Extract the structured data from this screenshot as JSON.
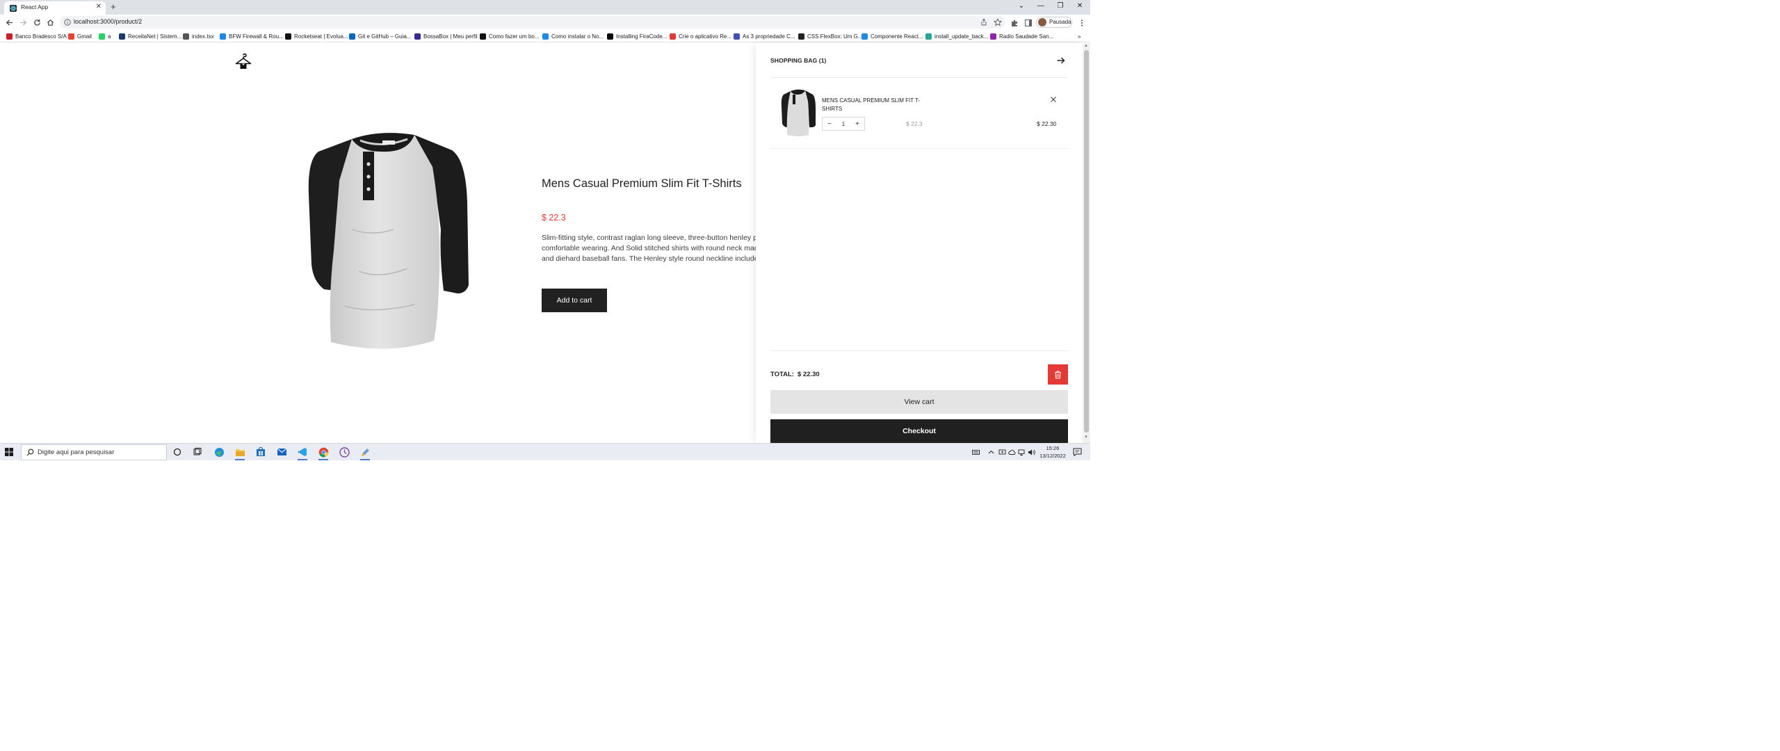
{
  "browser": {
    "tab_title": "React App",
    "tab_close": "✕",
    "new_tab": "+",
    "url": "localhost:3000/product/2",
    "profile_label": "Pausada",
    "window_controls": [
      "⌄",
      "—",
      "❐",
      "✕"
    ],
    "bookmarks": [
      {
        "label": "Banco Bradesco S/A",
        "color": "#cc1e2a"
      },
      {
        "label": "Gmail",
        "color": "#ea4335"
      },
      {
        "label": "a",
        "color": "#25d366"
      },
      {
        "label": "ReceitaNet | Sistem...",
        "color": "#1b3b6f"
      },
      {
        "label": "index.tsx",
        "color": "#555555"
      },
      {
        "label": "BFW Firewall & Rou...",
        "color": "#1e88e5"
      },
      {
        "label": "Rocketseat | Evolua...",
        "color": "#121214"
      },
      {
        "label": "Git e GitHub – Guia...",
        "color": "#0a66c2"
      },
      {
        "label": "BossaBox | Meu perfil",
        "color": "#3b2a8f"
      },
      {
        "label": "Como fazer um bo...",
        "color": "#121214"
      },
      {
        "label": "Como instalar o No...",
        "color": "#1e88e5"
      },
      {
        "label": "Installing FiraCode...",
        "color": "#0a0a0a"
      },
      {
        "label": "Crie o aplicativo Re...",
        "color": "#e53935"
      },
      {
        "label": "As 3 propriedade C...",
        "color": "#3f51b5"
      },
      {
        "label": "CSS FlexBox: Um G...",
        "color": "#222222"
      },
      {
        "label": "Componente React...",
        "color": "#1e88e5"
      },
      {
        "label": "install_update_back...",
        "color": "#26a69a"
      },
      {
        "label": "Radio Saudade San...",
        "color": "#8e24aa"
      }
    ],
    "bookmarks_more": "»"
  },
  "product": {
    "title": "Mens Casual Premium Slim Fit T-Shirts",
    "price": "$ 22.3",
    "description": "Slim-fitting style, contrast raglan long sleeve, three-button henley placket, light weight & soft fabric for breathable and comfortable wearing. And Solid stitched shirts with round neck made for durability and a great fit for casual fashion wear and diehard baseball fans. The Henley style round neckline includes a three-button placket.",
    "add_to_cart": "Add to cart"
  },
  "cart": {
    "heading": "SHOPPING BAG (1)",
    "items": [
      {
        "name": "MENS CASUAL PREMIUM SLIM FIT T-SHIRTS",
        "quantity": "1",
        "minus": "−",
        "plus": "+",
        "unit_price": "$ 22.3",
        "line_total": "$ 22.30"
      }
    ],
    "total_label": "TOTAL:",
    "total_value": "$ 22.30",
    "view_cart": "View cart",
    "checkout": "Checkout"
  },
  "taskbar": {
    "search_placeholder": "Digite aqui para pesquisar",
    "time": "15:26",
    "date": "13/12/2022"
  },
  "colors": {
    "accent_red": "#e53935",
    "dark_button": "#212121"
  }
}
